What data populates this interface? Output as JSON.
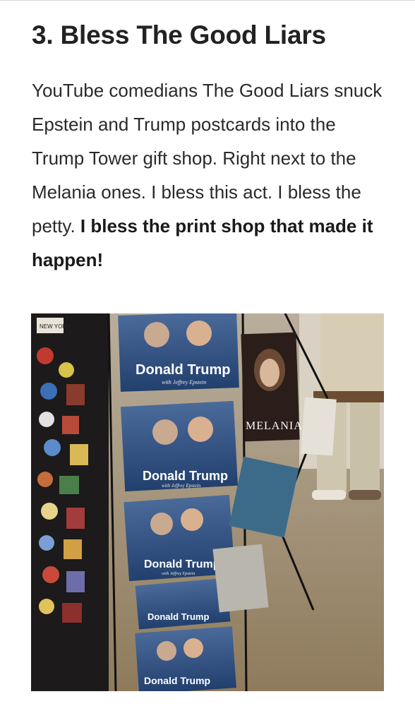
{
  "article": {
    "heading": "3. Bless The Good Liars",
    "paragraph_plain": "YouTube comedians The Good Liars snuck Epstein and Trump postcards into the Trump Tower gift shop. Right next to the Melania ones. I bless this act. I bless the petty. ",
    "paragraph_bold": "I bless the print shop that made it happen!"
  },
  "photo": {
    "postcard_title": "Donald Trump",
    "postcard_subtitle": "with Jeffrey Epstein",
    "melania_title": "MELANIA",
    "souvenir_label": "NEW YORK"
  },
  "colors": {
    "text": "#2a2a2a",
    "heading": "#222222",
    "postcard_blue": "#2d4f86",
    "floor": "#9a8a70"
  }
}
